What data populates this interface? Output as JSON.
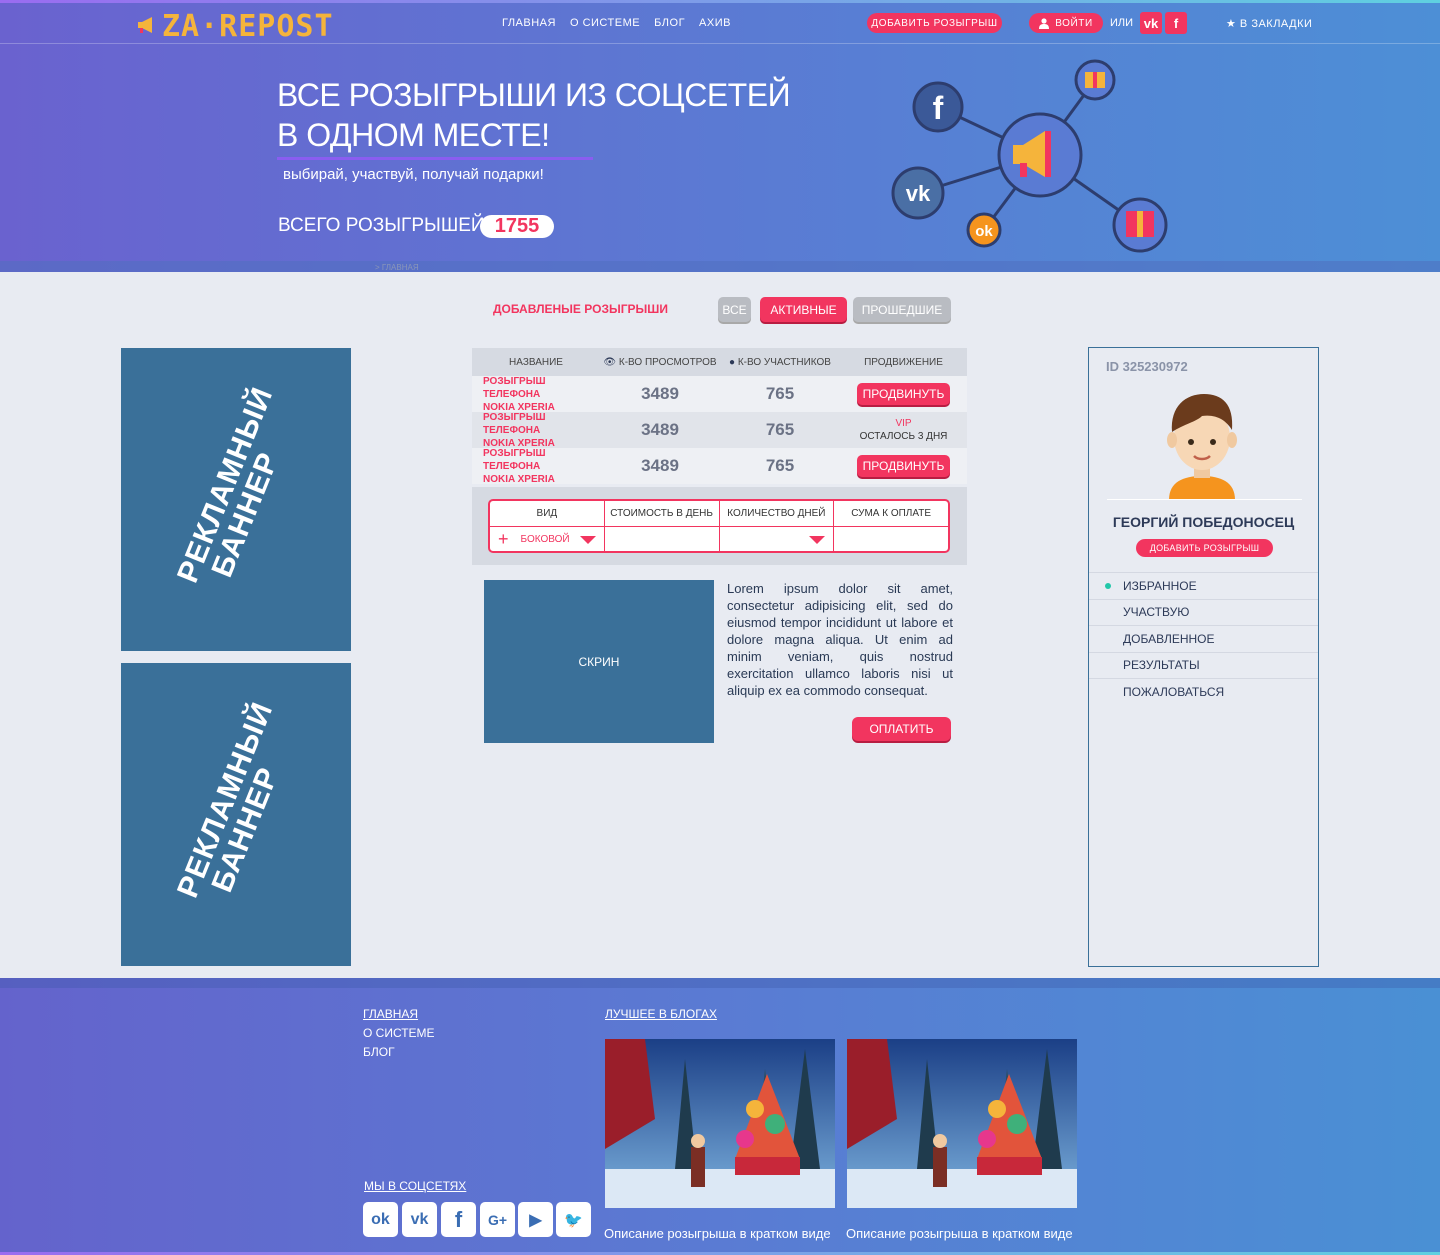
{
  "header": {
    "logo_text": "ZA·REPOST",
    "nav": [
      "ГЛАВНАЯ",
      "О СИСТЕМЕ",
      "БЛОГ",
      "АХИВ"
    ],
    "add_button": "ДОБАВИТЬ РОЗЫГРЫШ",
    "login_button": "ВОЙТИ",
    "or_text": "ИЛИ",
    "vk_icon": "vk-icon",
    "fb_icon": "facebook-icon",
    "bookmarks": "В ЗАКЛАДКИ"
  },
  "hero": {
    "title_line1": "ВСЕ РОЗЫГРЫШИ ИЗ СОЦСЕТЕЙ",
    "title_line2": "В ОДНОМ МЕСТЕ!",
    "subtitle": "выбирай, участвуй, получай подарки!",
    "total_label": "ВСЕГО РОЗЫГРЫШЕЙ",
    "total_count": "1755",
    "breadcrumb": "> ГЛАВНАЯ"
  },
  "main": {
    "section_title": "ДОБАВЛЕНЫЕ РОЗЫГРЫШИ",
    "filters": [
      "ВСЕ",
      "АКТИВНЫЕ",
      "ПРОШЕДШИЕ"
    ],
    "active_filter": "АКТИВНЫЕ",
    "table": {
      "headers": [
        "НАЗВАНИЕ",
        "К-ВО ПРОСМОТРОВ",
        "К-ВО УЧАСТНИКОВ",
        "ПРОДВИЖЕНИЕ"
      ],
      "rows": [
        {
          "name_line1": "РОЗЫГРЫШ ТЕЛЕФОНА",
          "name_line2": "NOKIA XPERIA",
          "views": "3489",
          "participants": "765",
          "promo": "ПРОДВИНУТЬ"
        },
        {
          "name_line1": "РОЗЫГРЫШ ТЕЛЕФОНА",
          "name_line2": "NOKIA XPERIA",
          "views": "3489",
          "participants": "765",
          "vip": "VIP",
          "vip_left": "ОСТАЛОСЬ 3 ДНЯ"
        },
        {
          "name_line1": "РОЗЫГРЫШ ТЕЛЕФОНА",
          "name_line2": "NOKIA XPERIA",
          "views": "3489",
          "participants": "765",
          "promo": "ПРОДВИНУТЬ"
        }
      ]
    },
    "calc": {
      "headers": [
        "ВИД",
        "СТОИМОСТЬ В ДЕНЬ",
        "КОЛИЧЕСТВО ДНЕЙ",
        "СУМА К ОПЛАТЕ"
      ],
      "type_value": "БОКОВОЙ"
    },
    "screen_label": "СКРИН",
    "description": "Lorem ipsum dolor sit amet, consectetur adipisicing elit, sed do eiusmod tempor incididunt ut labore et dolore magna aliqua. Ut enim ad minim veniam, quis nostrud exercitation ullamco laboris nisi ut aliquip ex ea commodo consequat.",
    "pay_button": "ОПЛАТИТЬ"
  },
  "banners": {
    "banner_line1": "РЕКЛАМНЫЙ",
    "banner_line2": "БАННЕР"
  },
  "profile": {
    "id": "ID 325230972",
    "name": "ГЕОРГИЙ ПОБЕДОНОСЕЦ",
    "add_button": "ДОБАВИТЬ РОЗЫГРЫШ",
    "menu": [
      "ИЗБРАННОЕ",
      "УЧАСТВУЮ",
      "ДОБАВЛЕННОЕ",
      "РЕЗУЛЬТАТЫ",
      "ПОЖАЛОВАТЬСЯ"
    ]
  },
  "footer": {
    "links": [
      "ГЛАВНАЯ",
      "О СИСТЕМЕ",
      "БЛОГ"
    ],
    "social_title": "МЫ В СОЦСЕТЯХ",
    "social_icons": [
      "odnoklassniki-icon",
      "vk-icon",
      "facebook-icon",
      "google-plus-icon",
      "youtube-icon",
      "twitter-icon"
    ],
    "blog_title": "ЛУЧШЕЕ В БЛОГАХ",
    "blog_captions": [
      "Описание розыгрыша в кратком виде",
      "Описание розыгрыша в кратком виде"
    ]
  },
  "colors": {
    "accent": "#f2355f",
    "banner": "#3a7099",
    "logo": "#f5b43b"
  }
}
